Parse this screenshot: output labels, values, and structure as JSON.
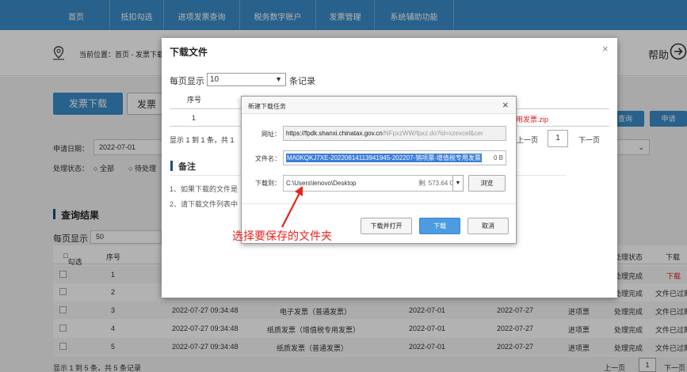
{
  "nav": {
    "items": [
      "首页",
      "抵扣勾选",
      "进项发票查询",
      "税务数字账户",
      "发票管理",
      "系统辅助功能"
    ]
  },
  "breadcrumb": {
    "text": "当前位置：首页 - 发票下载"
  },
  "help": {
    "label": "帮助"
  },
  "page": {
    "tabs": {
      "active": "发票下载",
      "inactive": "发票"
    },
    "right_buttons": {
      "query": "查询",
      "apply": "申请"
    },
    "apply_date_label": "申请日期：",
    "apply_date_value": "2022-07-01",
    "status_label": "处理状态：",
    "status_all": "全部",
    "status_pending": "待处理",
    "results_title": "查询结果",
    "per_page_label": "每页显示",
    "per_page_value": "50",
    "select_col": "勾选",
    "columns": {
      "seq": "序号",
      "status": "处理状态",
      "download": "下载"
    },
    "rows": [
      {
        "seq": "1",
        "time": "",
        "type": "",
        "month": "",
        "date": "",
        "kind": "",
        "status": "处理完成",
        "dl": "下载"
      },
      {
        "seq": "2",
        "time": "",
        "type": "",
        "month": "",
        "date": "",
        "kind": "",
        "status": "处理完成",
        "dl": "文件已过期"
      },
      {
        "seq": "3",
        "time": "2022-07-27 09:34:48",
        "type": "电子发票（普通发票）",
        "month": "2022-07-01",
        "date": "2022-07-27",
        "kind": "进项票",
        "status": "处理完成",
        "dl": "文件已过期"
      },
      {
        "seq": "4",
        "time": "2022-07-27 09:34:48",
        "type": "纸质发票（增值税专用发票）",
        "month": "2022-07-01",
        "date": "2022-07-27",
        "kind": "进项票",
        "status": "处理完成",
        "dl": "文件已过期"
      },
      {
        "seq": "5",
        "time": "2022-07-27 09:34:48",
        "type": "纸质发票（普通发票）",
        "month": "2022-07-01",
        "date": "2022-07-27",
        "kind": "进项票",
        "status": "处理完成",
        "dl": "文件已过期"
      }
    ],
    "footer_text": "显示 1 到 5 条，共 5 条记录",
    "prev_page": "上一页",
    "page_num": "1",
    "next_page": "下一页"
  },
  "modal": {
    "title": "下载文件",
    "close": "×",
    "per_page_label": "每页显示",
    "per_page_value": "10",
    "records_suffix": "条记录",
    "col_seq": "序号",
    "row_seq": "1",
    "row_file": "用发票.zip",
    "footer_text": "显示 1 到 1 条，共 1",
    "prev_page": "上一页",
    "page_num": "1",
    "next_page": "下一页",
    "notes_title": "备注",
    "note1": "1、如果下载的文件是",
    "note2": "2、请下载文件列表中"
  },
  "dialog": {
    "title": "新建下载任务",
    "close": "×",
    "url_label": "网址：",
    "url_domain": "https://fpdk.shanxi.chinatax.gov.cn",
    "url_path": "/NFpxzWW/fpxz.do?id=xzexcel&cer",
    "filename_label": "文件名：",
    "filename_value": "MA0KQKJ7XE-20220814113941945-202207-销项票-增值税专用发票",
    "filesize": "0 B",
    "saveto_label": "下载到：",
    "saveto_value": "C:\\Users\\lenovo\\Desktop",
    "free_space": "剩: 573.64 GB",
    "browse": "浏览",
    "btn_open": "下载并打开",
    "btn_download": "下载",
    "btn_cancel": "取消"
  },
  "annotation": {
    "text": "选择要保存的文件夹"
  },
  "colors": {
    "nav_blue": "#3a8cc7",
    "annotation_red": "#e8231f",
    "link_red": "#d9211c"
  }
}
